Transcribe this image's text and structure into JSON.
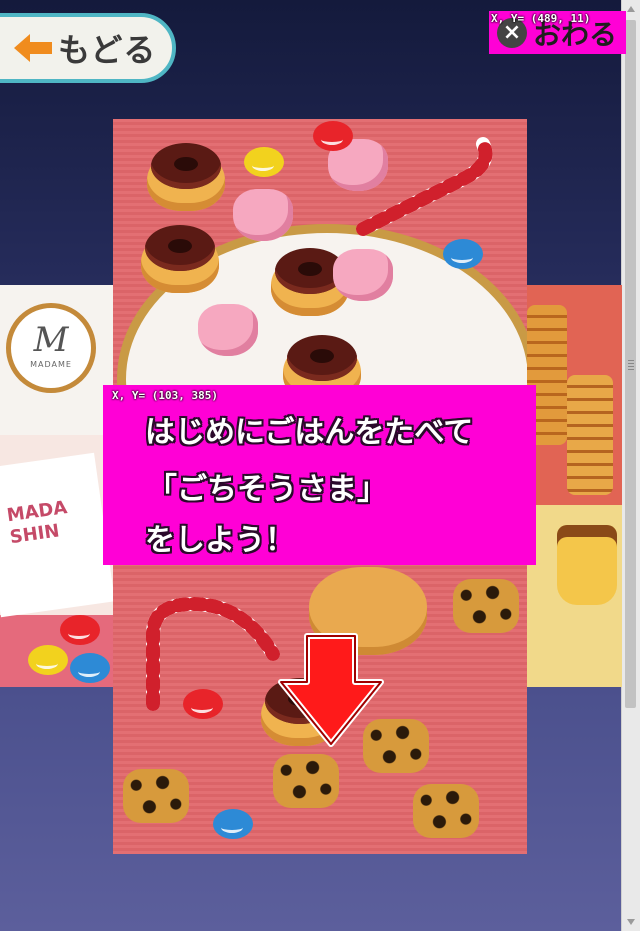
{
  "header": {
    "back_label": "もどる",
    "exit_label": "おわる",
    "exit_coord": "X, Y= (489, 11)"
  },
  "side_panels": {
    "left_logo_letter": "M",
    "left_logo_text": "MADAME",
    "left_brand_text": "MADA SHIN"
  },
  "instruction": {
    "coord": "X, Y= (103, 385)",
    "line1": "はじめにごはんをたべて",
    "line2": "「ごちそうさま」",
    "line3": "をしよう！"
  },
  "colors": {
    "highlight": "#ff00d6",
    "back_border": "#4fb6c4",
    "arrow": "#ff1a1a"
  },
  "icons": {
    "back": "left-arrow-icon",
    "exit": "close-circle-icon",
    "pointer": "down-arrow-icon"
  }
}
